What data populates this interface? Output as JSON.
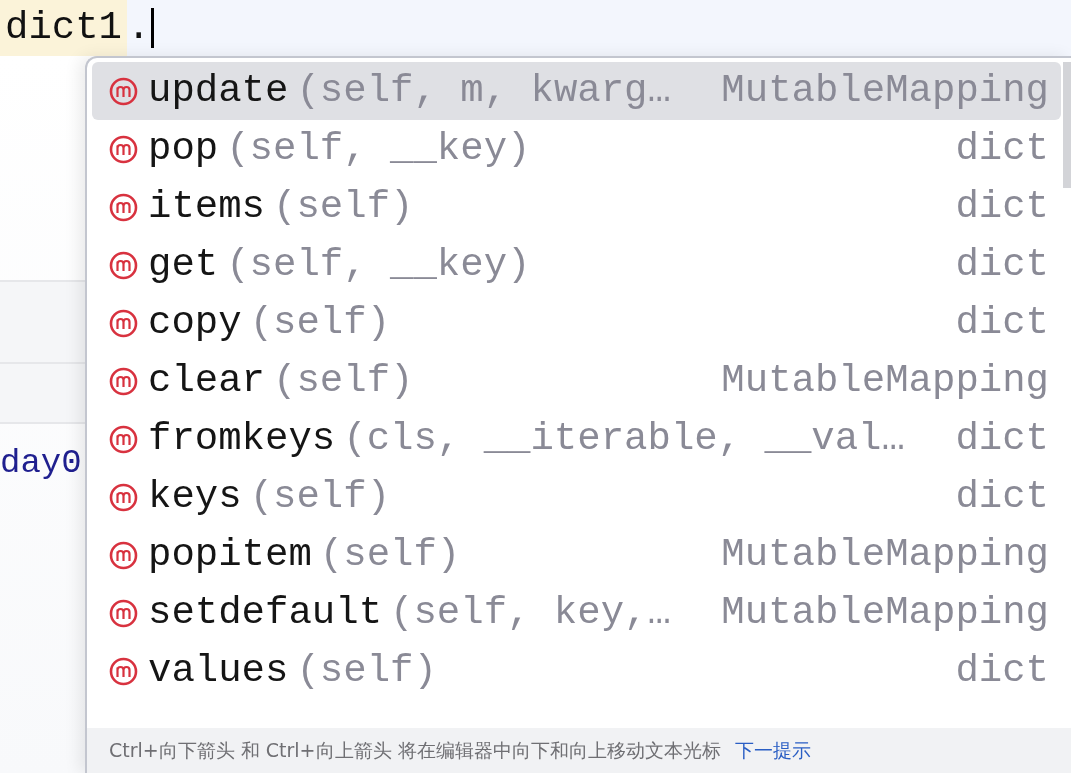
{
  "editor": {
    "code": "dict1",
    "typed": "."
  },
  "background_code": "day0",
  "completions": [
    {
      "kind": "method",
      "name": "update",
      "signature": "(self, m, kwarg…",
      "type": "MutableMapping",
      "selected": true
    },
    {
      "kind": "method",
      "name": "pop",
      "signature": "(self, __key)",
      "type": "dict",
      "selected": false
    },
    {
      "kind": "method",
      "name": "items",
      "signature": "(self)",
      "type": "dict",
      "selected": false
    },
    {
      "kind": "method",
      "name": "get",
      "signature": "(self, __key)",
      "type": "dict",
      "selected": false
    },
    {
      "kind": "method",
      "name": "copy",
      "signature": "(self)",
      "type": "dict",
      "selected": false
    },
    {
      "kind": "method",
      "name": "clear",
      "signature": "(self)",
      "type": "MutableMapping",
      "selected": false
    },
    {
      "kind": "method",
      "name": "fromkeys",
      "signature": "(cls, __iterable, __val…",
      "type": "dict",
      "selected": false
    },
    {
      "kind": "method",
      "name": "keys",
      "signature": "(self)",
      "type": "dict",
      "selected": false
    },
    {
      "kind": "method",
      "name": "popitem",
      "signature": "(self)",
      "type": "MutableMapping",
      "selected": false
    },
    {
      "kind": "method",
      "name": "setdefault",
      "signature": "(self, key,…",
      "type": "MutableMapping",
      "selected": false
    },
    {
      "kind": "method",
      "name": "values",
      "signature": "(self)",
      "type": "dict",
      "selected": false
    }
  ],
  "footer": {
    "hint": "Ctrl+向下箭头 和 Ctrl+向上箭头 将在编辑器中向下和向上移动文本光标",
    "link": "下一提示"
  }
}
